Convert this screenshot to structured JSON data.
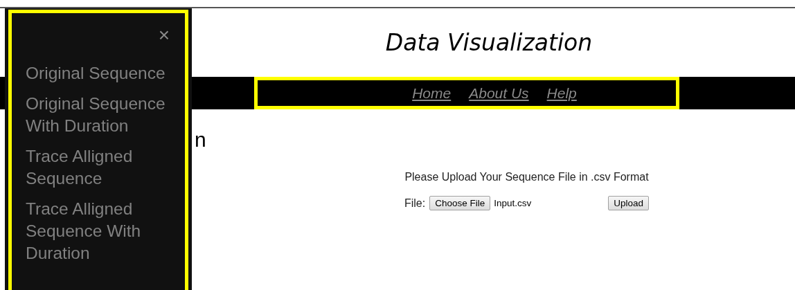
{
  "header": {
    "title": "Data Visualization"
  },
  "nav": {
    "links": [
      {
        "label": "Home"
      },
      {
        "label": "About Us"
      },
      {
        "label": "Help"
      }
    ]
  },
  "heading": "n",
  "upload": {
    "prompt": "Please Upload Your Sequence File in .csv Format",
    "file_label": "File:",
    "choose_button": "Choose File",
    "file_name": "Input.csv",
    "upload_button": "Upload"
  },
  "sidebar": {
    "close": "×",
    "items": [
      {
        "label": "Original Sequence"
      },
      {
        "label": "Original Sequence With Duration"
      },
      {
        "label": "Trace Alligned Sequence"
      },
      {
        "label": "Trace Alligned Sequence With Duration"
      }
    ]
  }
}
